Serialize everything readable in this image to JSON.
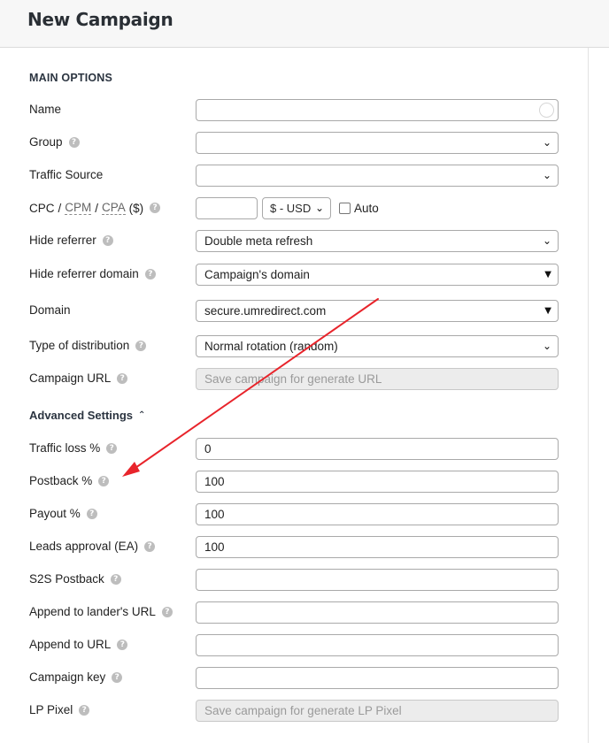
{
  "header": {
    "title": "New Campaign"
  },
  "main_options": {
    "section_title": "MAIN OPTIONS",
    "name": {
      "label": "Name",
      "value": ""
    },
    "group": {
      "label": "Group",
      "value": ""
    },
    "traffic_source": {
      "label": "Traffic Source",
      "value": ""
    },
    "cost": {
      "label_cpc": "CPC",
      "label_sep1": "/",
      "label_cpm": "CPM",
      "label_sep2": "/",
      "label_cpa": "CPA",
      "label_unit": "($)",
      "value": "",
      "currency": "$ - USD",
      "auto_label": "Auto",
      "auto_checked": false
    },
    "hide_referrer": {
      "label": "Hide referrer",
      "value": "Double meta refresh"
    },
    "hide_referrer_domain": {
      "label": "Hide referrer domain",
      "value": "Campaign's domain"
    },
    "domain": {
      "label": "Domain",
      "value": "secure.umredirect.com"
    },
    "distribution": {
      "label": "Type of distribution",
      "value": "Normal rotation (random)"
    },
    "campaign_url": {
      "label": "Campaign URL",
      "placeholder": "Save campaign for generate URL"
    }
  },
  "advanced": {
    "title": "Advanced Settings",
    "traffic_loss": {
      "label": "Traffic loss %",
      "value": "0"
    },
    "postback": {
      "label": "Postback %",
      "value": "100"
    },
    "payout": {
      "label": "Payout %",
      "value": "100"
    },
    "leads_approval": {
      "label": "Leads approval (EA)",
      "value": "100"
    },
    "s2s_postback": {
      "label": "S2S Postback",
      "value": ""
    },
    "append_lander_url": {
      "label": "Append to lander's URL",
      "value": ""
    },
    "append_url": {
      "label": "Append to URL",
      "value": ""
    },
    "campaign_key": {
      "label": "Campaign key",
      "value": ""
    },
    "lp_pixel": {
      "label": "LP Pixel",
      "placeholder": "Save campaign for generate LP Pixel"
    }
  },
  "icons": {
    "help": "question-circle-icon",
    "select_arrow": "chevron-down-icon",
    "collapse": "chevron-up-icon"
  },
  "colors": {
    "annotation_arrow": "#e8242b",
    "header_bg": "#f7f7f7",
    "disabled_field_bg": "#ececec"
  }
}
